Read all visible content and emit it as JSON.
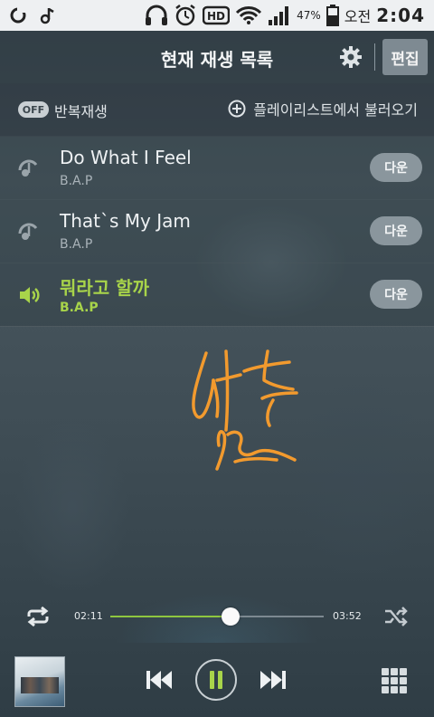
{
  "status_bar": {
    "battery_pct": "47%",
    "hd_label": "HD",
    "ampm": "오전",
    "time": "2:04"
  },
  "header": {
    "title": "현재 재생 목록",
    "edit_label": "편집"
  },
  "options": {
    "repeat_state": "OFF",
    "repeat_label": "반복재생",
    "load_playlist_label": "플레이리스트에서 불러오기"
  },
  "songs": [
    {
      "title": "Do What I Feel",
      "artist": "B.A.P",
      "download_label": "다운",
      "active": false
    },
    {
      "title": "That`s My Jam",
      "artist": "B.A.P",
      "download_label": "다운",
      "active": false
    },
    {
      "title": "뭐라고 할까",
      "artist": "B.A.P",
      "download_label": "다운",
      "active": true
    }
  ],
  "player": {
    "current_time": "02:11",
    "total_time": "03:52",
    "progress_fraction": 0.565
  },
  "colors": {
    "accent_green": "#a8d44a",
    "signature_orange": "#f29a2e"
  }
}
